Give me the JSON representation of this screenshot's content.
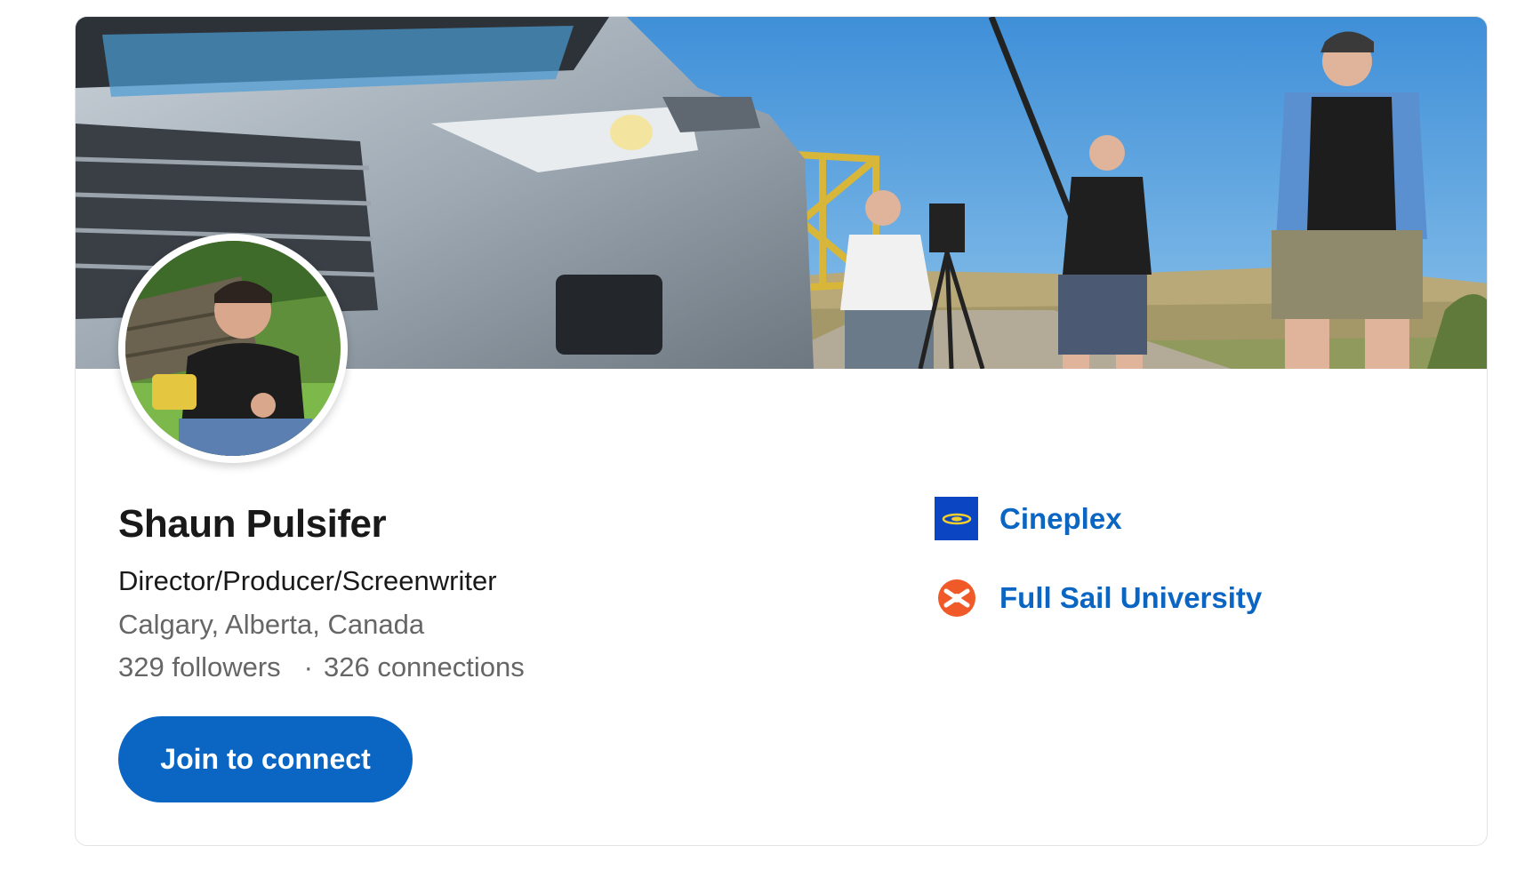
{
  "profile": {
    "name": "Shaun Pulsifer",
    "headline": "Director/Producer/Screenwriter",
    "location": "Calgary, Alberta, Canada",
    "followers": "329 followers",
    "separator": "·",
    "connections": "326 connections",
    "join_label": "Join to connect"
  },
  "organizations": [
    {
      "name": "Cineplex",
      "logo_icon": "cineplex-logo-icon",
      "logo_color": "#0b45c2"
    },
    {
      "name": "Full Sail University",
      "logo_icon": "full-sail-logo-icon",
      "logo_color": "#f05a28"
    }
  ],
  "colors": {
    "accent": "#0a66c2",
    "muted_text": "#666666"
  }
}
